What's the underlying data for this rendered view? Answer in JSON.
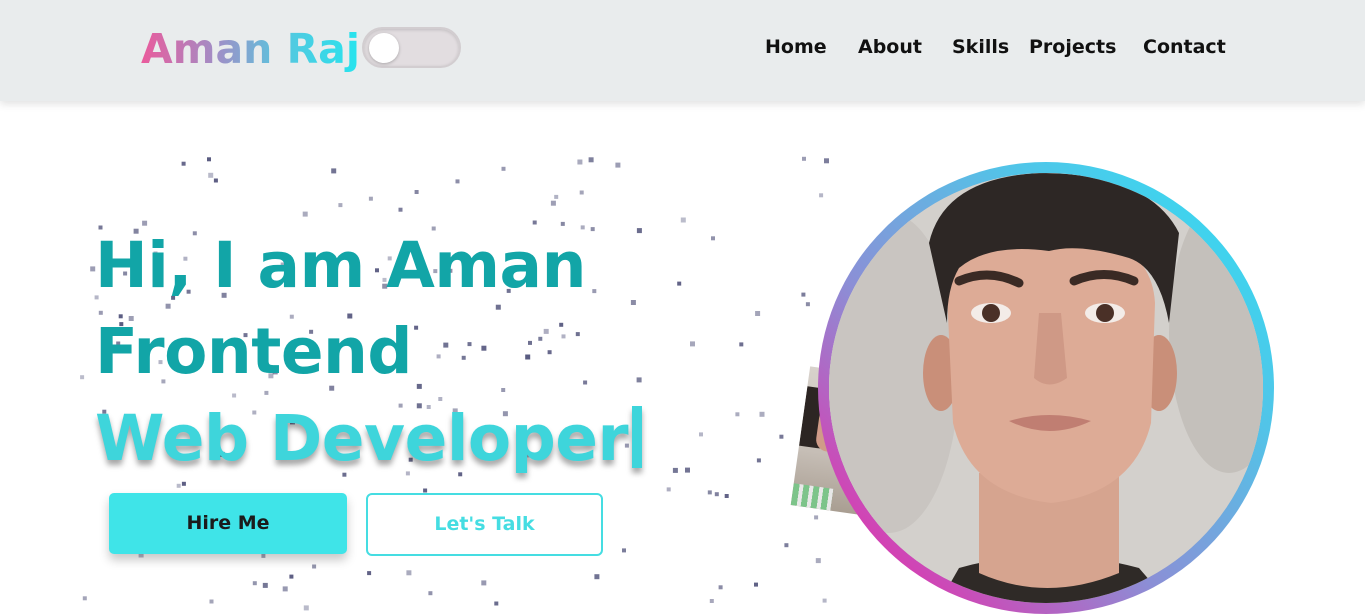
{
  "header": {
    "logo_text": "Aman Raj",
    "theme_toggle_state": "off",
    "nav": [
      {
        "label": "Home"
      },
      {
        "label": "About"
      },
      {
        "label": "Skills"
      },
      {
        "label": "Projects"
      },
      {
        "label": "Contact"
      }
    ]
  },
  "hero": {
    "line1": "Hi, I am Aman",
    "line2": "Frontend",
    "line3": "Web Developer",
    "buttons": {
      "hire": "Hire Me",
      "talk": "Let's Talk"
    }
  },
  "colors": {
    "heading": "#12a5a7",
    "typed_text": "#3ed5db",
    "primary_button": "#3fe4e8",
    "navbar_bg": "#e9eced",
    "particle": "#3d3f6b"
  }
}
